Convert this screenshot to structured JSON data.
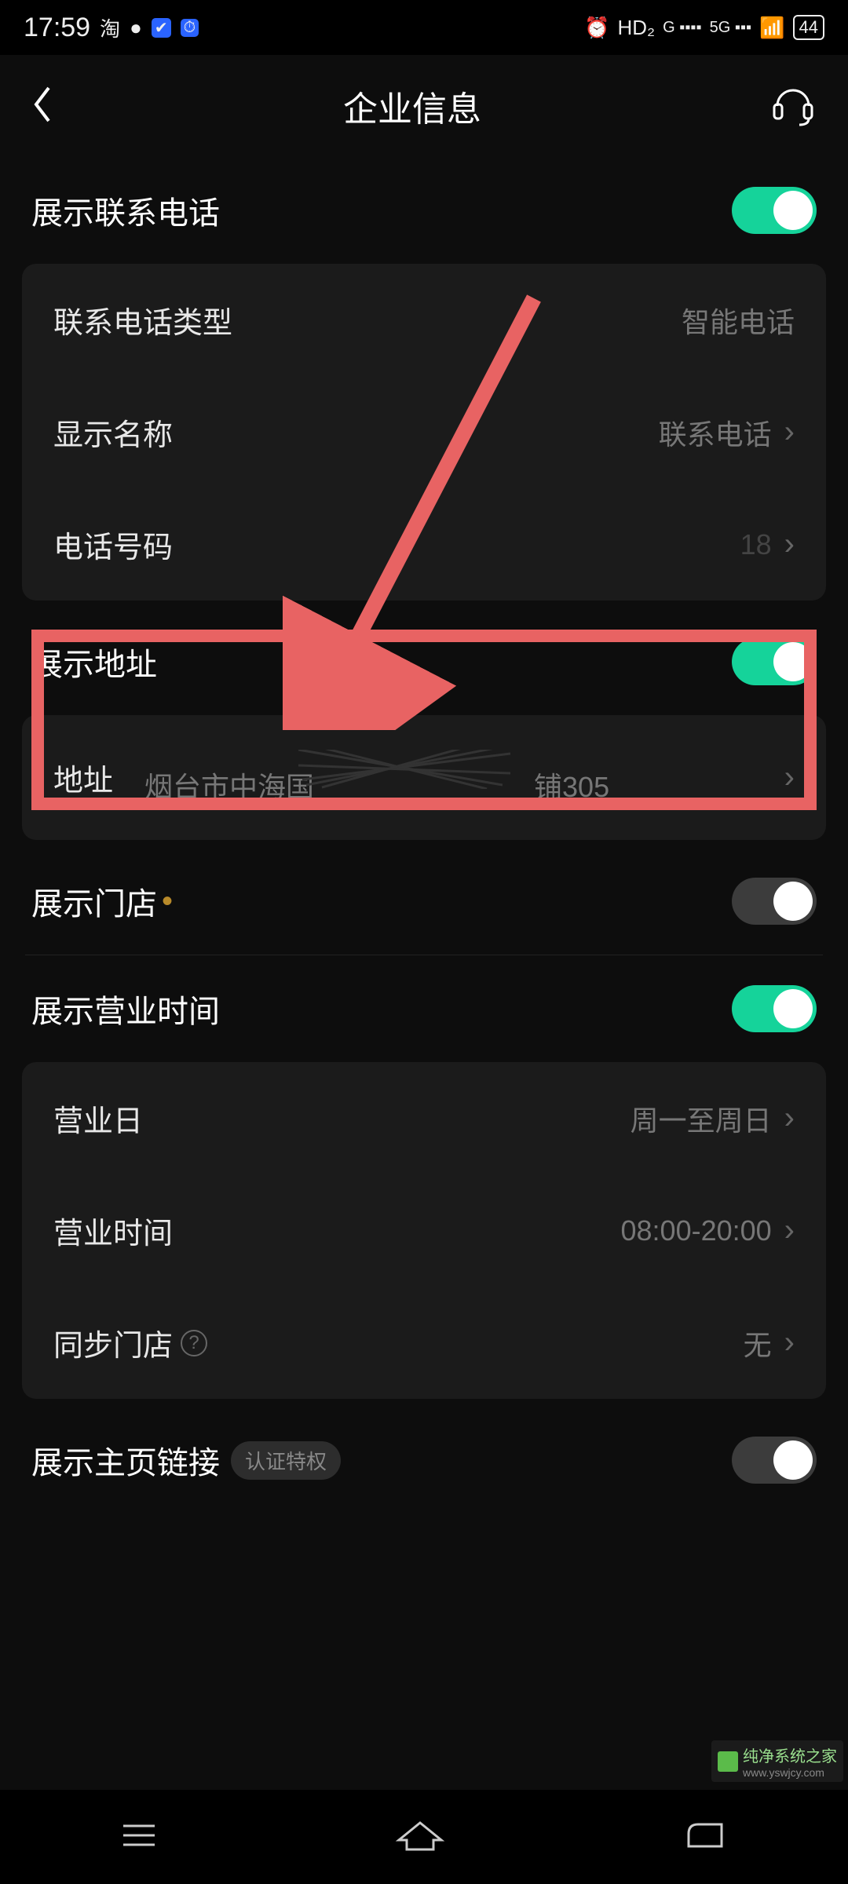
{
  "status": {
    "time": "17:59",
    "left_icons": [
      "淘",
      "●",
      "✔",
      "⏱"
    ],
    "right_icons": [
      "⏰",
      "HD₂",
      "G ▪▪▪▪",
      "5G ▪▪▪",
      "📶"
    ],
    "battery": "44"
  },
  "header": {
    "title": "企业信息"
  },
  "section_phone": {
    "toggle_label": "展示联系电话",
    "toggle_on": true,
    "row_type": {
      "label": "联系电话类型",
      "value": "智能电话"
    },
    "row_name": {
      "label": "显示名称",
      "value": "联系电话"
    },
    "row_number": {
      "label": "电话号码",
      "value": "18"
    }
  },
  "section_address": {
    "toggle_label": "展示地址",
    "toggle_on": true,
    "row_addr": {
      "label": "地址",
      "value_prefix": "烟台市中海国",
      "value_suffix": "铺305"
    }
  },
  "section_store": {
    "toggle_label": "展示门店",
    "toggle_on": false
  },
  "section_hours": {
    "toggle_label": "展示营业时间",
    "toggle_on": true,
    "row_days": {
      "label": "营业日",
      "value": "周一至周日"
    },
    "row_hours": {
      "label": "营业时间",
      "value": "08:00-20:00"
    },
    "row_sync": {
      "label": "同步门店",
      "value": "无"
    }
  },
  "section_link": {
    "toggle_label": "展示主页链接",
    "badge": "认证特权",
    "toggle_on": false
  },
  "watermark": {
    "brand": "纯净系统之家",
    "url": "www.yswjcy.com"
  },
  "annotation": {
    "color": "#e86363"
  }
}
